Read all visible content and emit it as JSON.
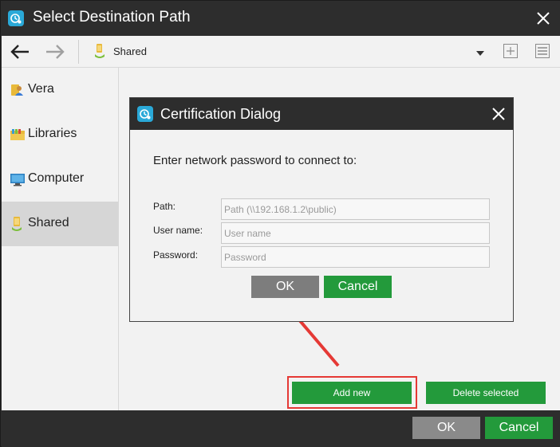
{
  "window": {
    "title": "Select Destination Path"
  },
  "toolbar": {
    "location": "Shared"
  },
  "sidebar": {
    "items": [
      {
        "label": "Vera"
      },
      {
        "label": "Libraries"
      },
      {
        "label": "Computer"
      },
      {
        "label": "Shared"
      }
    ],
    "active": "Shared"
  },
  "main": {
    "add_new_label": "Add new",
    "delete_selected_label": "Delete selected"
  },
  "footer": {
    "ok_label": "OK",
    "cancel_label": "Cancel"
  },
  "dialog": {
    "title": "Certification Dialog",
    "prompt": "Enter network password to connect to:",
    "path_label": "Path:",
    "path_placeholder": "Path (\\\\192.168.1.2\\public)",
    "username_label": "User name:",
    "username_placeholder": "User name",
    "password_label": "Password:",
    "password_placeholder": "Password",
    "ok_label": "OK",
    "cancel_label": "Cancel"
  },
  "colors": {
    "accent_green": "#239a3b",
    "title_bar": "#2d2d2d",
    "highlight_red": "#e53935",
    "app_icon_blue": "#2aa9d8"
  },
  "icons": {
    "app": "app-logo-icon",
    "back": "arrow-left-icon",
    "forward": "arrow-right-icon",
    "location": "shared-folder-icon",
    "new_folder": "plus-square-icon",
    "view": "list-view-icon"
  }
}
